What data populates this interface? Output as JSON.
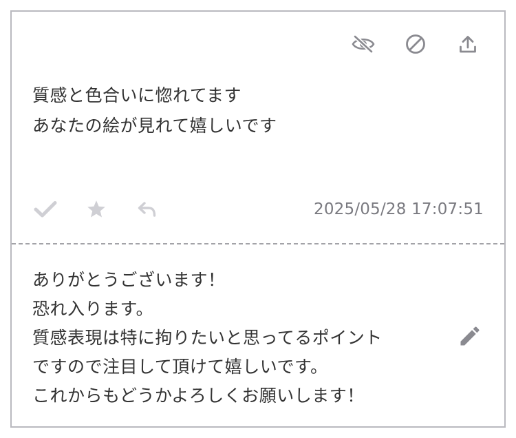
{
  "message": {
    "lines": [
      "質感と色合いに惚れてます",
      "あなたの絵が見れて嬉しいです"
    ]
  },
  "top_actions": {
    "icons": [
      "eye-off-icon",
      "block-icon",
      "upload-icon"
    ]
  },
  "bottom_actions": {
    "icons": [
      "check-icon",
      "star-icon",
      "reply-icon"
    ]
  },
  "timestamp": "2025/05/28 17:07:51",
  "reply": {
    "lines": [
      "ありがとうございます！",
      "恐れ入ります。",
      "質感表現は特に拘りたいと思ってるポイント",
      "ですので注目して頂けて嬉しいです。",
      "これからもどうかよろしくお願いします！"
    ]
  },
  "edit": {
    "icon": "pencil-icon"
  },
  "colors": {
    "border": "#b9b9bf",
    "icon_dark": "#8a8a90",
    "icon_light": "#cfcfd4",
    "text": "#333333",
    "muted": "#7a7a80"
  }
}
